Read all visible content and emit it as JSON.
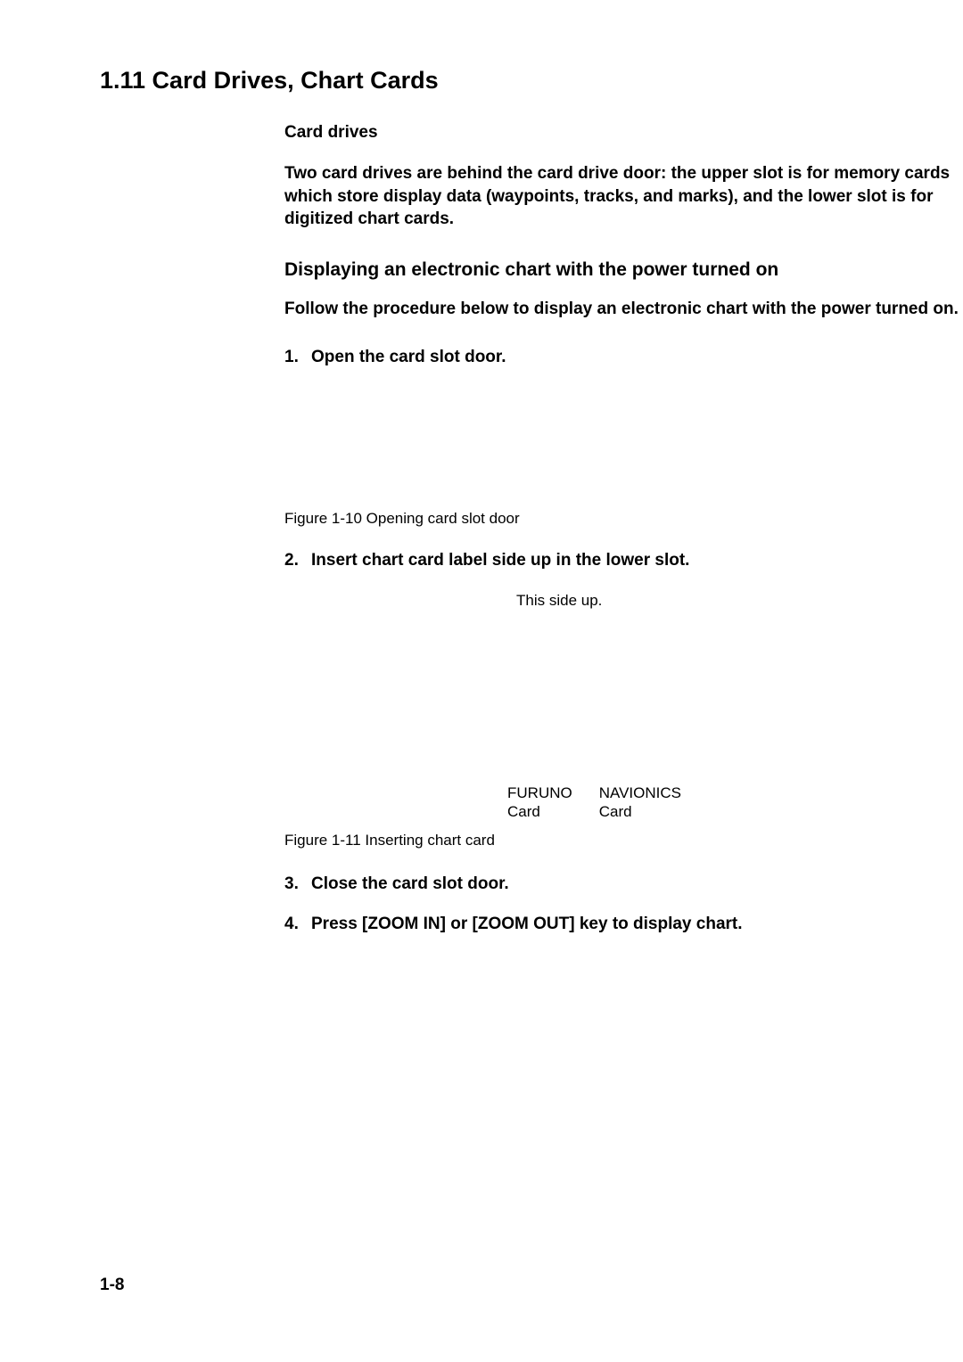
{
  "section": {
    "title": "1.11 Card Drives, Chart Cards"
  },
  "cardDrives": {
    "heading": "Card drives",
    "body": "Two card drives are behind the card drive door: the upper slot is for memory cards which store display data (waypoints, tracks, and marks), and the lower slot is for digitized chart cards."
  },
  "displaying": {
    "heading": "Displaying an electronic chart with the power turned on",
    "body": "Follow the procedure below to display an electronic chart with the power turned on."
  },
  "steps": {
    "s1": {
      "num": "1.",
      "text": "Open the card slot door."
    },
    "s2": {
      "num": "2.",
      "text": "Insert chart card label side up in the lower slot."
    },
    "s3": {
      "num": "3.",
      "text": "Close the card slot door."
    },
    "s4": {
      "num": "4.",
      "text": "Press [ZOOM IN] or [ZOOM OUT] key to display chart."
    }
  },
  "figures": {
    "f1": "Figure 1-10 Opening card slot door",
    "f2": "Figure 1-11 Inserting chart card",
    "thisSideUp": "This side up.",
    "furuno": "FURUNO\nCard",
    "navionics": "NAVIONICS\nCard"
  },
  "pageNumber": "1-8"
}
